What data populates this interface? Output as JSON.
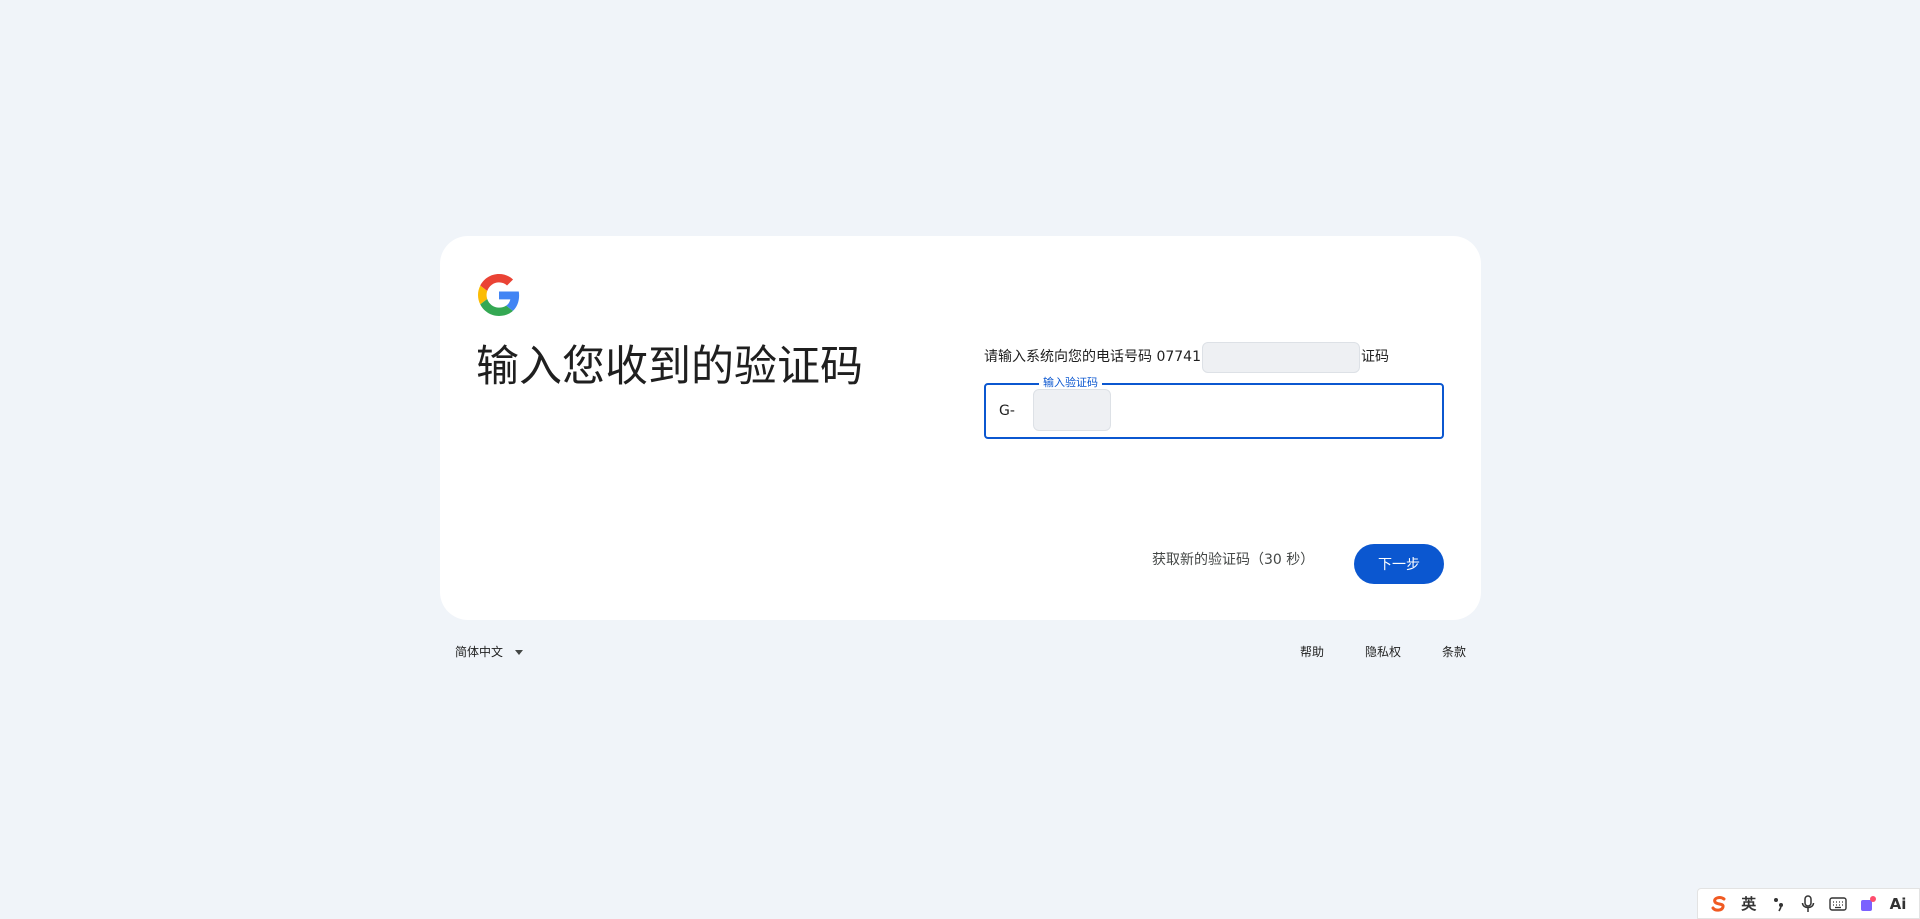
{
  "heading": "输入您收到的验证码",
  "description": {
    "before": "请输入系统向您的电话号码 07741",
    "after": "证码"
  },
  "code_field": {
    "label": "输入验证码",
    "prefix": "G-",
    "value": ""
  },
  "actions": {
    "resend_label": "获取新的验证码（30 秒）",
    "next_label": "下一步"
  },
  "footer": {
    "language": "简体中文",
    "links": [
      "帮助",
      "隐私权",
      "条款"
    ]
  },
  "ime_tray": {
    "lang_label": "英",
    "ai_label": "Ai"
  },
  "colors": {
    "accent": "#0b57d0",
    "background": "#f0f4f9",
    "card": "#ffffff"
  }
}
